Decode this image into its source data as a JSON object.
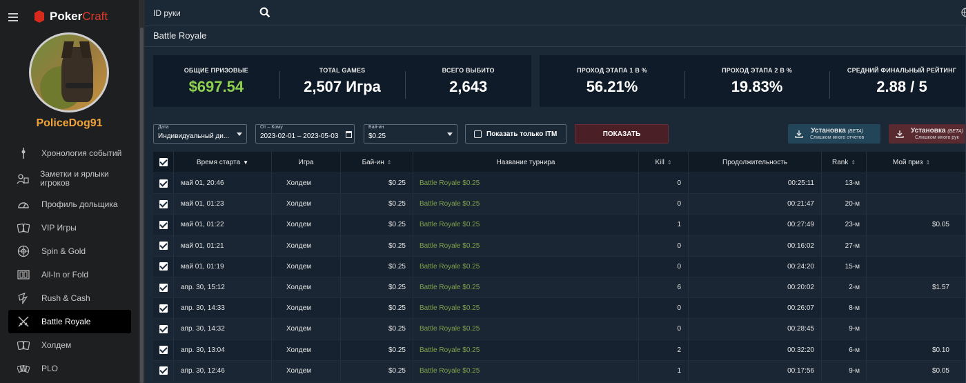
{
  "app": {
    "brand_part1": "Poker",
    "brand_part2": "Craft",
    "username": "PoliceDog91"
  },
  "sidebar": {
    "items": [
      {
        "label": "Хронология событий",
        "icon": "timeline-icon"
      },
      {
        "label": "Заметки и ярлыки игроков",
        "icon": "notes-icon"
      },
      {
        "label": "Профиль дольщика",
        "icon": "gauge-icon"
      },
      {
        "label": "VIP Игры",
        "icon": "cards-icon"
      },
      {
        "label": "Spin & Gold",
        "icon": "spin-icon"
      },
      {
        "label": "All-In or Fold",
        "icon": "allin-icon"
      },
      {
        "label": "Rush & Cash",
        "icon": "rush-icon"
      },
      {
        "label": "Battle Royale",
        "icon": "swords-icon",
        "active": true
      },
      {
        "label": "Холдем",
        "icon": "holdem-cards-icon"
      },
      {
        "label": "PLO",
        "icon": "plo-cards-icon"
      }
    ]
  },
  "search": {
    "label": "ID руки"
  },
  "page": {
    "title": "Battle Royale"
  },
  "stats_left": [
    {
      "label": "ОБЩИЕ ПРИЗОВЫЕ",
      "value": "$697.54",
      "color": "#8fd14f"
    },
    {
      "label": "TOTAL GAMES",
      "value": "2,507 Игра"
    },
    {
      "label": "ВСЕГО ВЫБИТО",
      "value": "2,643"
    }
  ],
  "stats_right": [
    {
      "label": "ПРОХОД ЭТАПА 1 В %",
      "value": "56.21%"
    },
    {
      "label": "ПРОХОД ЭТАПА 2 В %",
      "value": "19.83%"
    },
    {
      "label": "СРЕДНИЙ ФИНАЛЬНЫЙ РЕЙТИНГ",
      "value": "2.88 / 5"
    }
  ],
  "filters": {
    "date": {
      "label": "Дата",
      "value": "Индивидуальный ди..."
    },
    "range": {
      "label": "От – Кому",
      "value": "2023-02-01 – 2023-05-03"
    },
    "buyin": {
      "label": "Бай-ин",
      "value": "$0.25"
    },
    "itm_label": "Показать только ITM",
    "show_button": "ПОКАЗАТЬ",
    "install1": {
      "title": "Установка",
      "beta": "(BETA)",
      "sub": "Слишком много отчетов"
    },
    "install2": {
      "title": "Установка",
      "beta": "(BETA)",
      "sub": "Слишком много рук"
    }
  },
  "table": {
    "headers": {
      "start_time": "Время старта",
      "game": "Игра",
      "buyin": "Бай-ин",
      "tournament": "Название турнира",
      "kill": "Kill",
      "duration": "Продолжительность",
      "rank": "Rank",
      "prize": "Мой приз"
    },
    "rows": [
      {
        "time": "май 01, 20:46",
        "game": "Холдем",
        "buyin": "$0.25",
        "name": "Battle Royale $0.25",
        "kill": "0",
        "duration": "00:25:11",
        "rank": "13-м",
        "prize": ""
      },
      {
        "time": "май 01, 01:23",
        "game": "Холдем",
        "buyin": "$0.25",
        "name": "Battle Royale $0.25",
        "kill": "0",
        "duration": "00:21:47",
        "rank": "20-м",
        "prize": ""
      },
      {
        "time": "май 01, 01:22",
        "game": "Холдем",
        "buyin": "$0.25",
        "name": "Battle Royale $0.25",
        "kill": "1",
        "duration": "00:27:49",
        "rank": "23-м",
        "prize": "$0.05"
      },
      {
        "time": "май 01, 01:21",
        "game": "Холдем",
        "buyin": "$0.25",
        "name": "Battle Royale $0.25",
        "kill": "0",
        "duration": "00:16:02",
        "rank": "27-м",
        "prize": ""
      },
      {
        "time": "май 01, 01:19",
        "game": "Холдем",
        "buyin": "$0.25",
        "name": "Battle Royale $0.25",
        "kill": "0",
        "duration": "00:24:20",
        "rank": "15-м",
        "prize": ""
      },
      {
        "time": "апр. 30, 15:12",
        "game": "Холдем",
        "buyin": "$0.25",
        "name": "Battle Royale $0.25",
        "kill": "6",
        "duration": "00:20:02",
        "rank": "2-м",
        "prize": "$1.57"
      },
      {
        "time": "апр. 30, 14:33",
        "game": "Холдем",
        "buyin": "$0.25",
        "name": "Battle Royale $0.25",
        "kill": "0",
        "duration": "00:26:07",
        "rank": "8-м",
        "prize": ""
      },
      {
        "time": "апр. 30, 14:32",
        "game": "Холдем",
        "buyin": "$0.25",
        "name": "Battle Royale $0.25",
        "kill": "0",
        "duration": "00:28:45",
        "rank": "9-м",
        "prize": ""
      },
      {
        "time": "апр. 30, 13:04",
        "game": "Холдем",
        "buyin": "$0.25",
        "name": "Battle Royale $0.25",
        "kill": "2",
        "duration": "00:32:20",
        "rank": "6-м",
        "prize": "$0.10"
      },
      {
        "time": "апр. 30, 12:46",
        "game": "Холдем",
        "buyin": "$0.25",
        "name": "Battle Royale $0.25",
        "kill": "1",
        "duration": "00:17:56",
        "rank": "9-м",
        "prize": "$0.05"
      }
    ]
  }
}
